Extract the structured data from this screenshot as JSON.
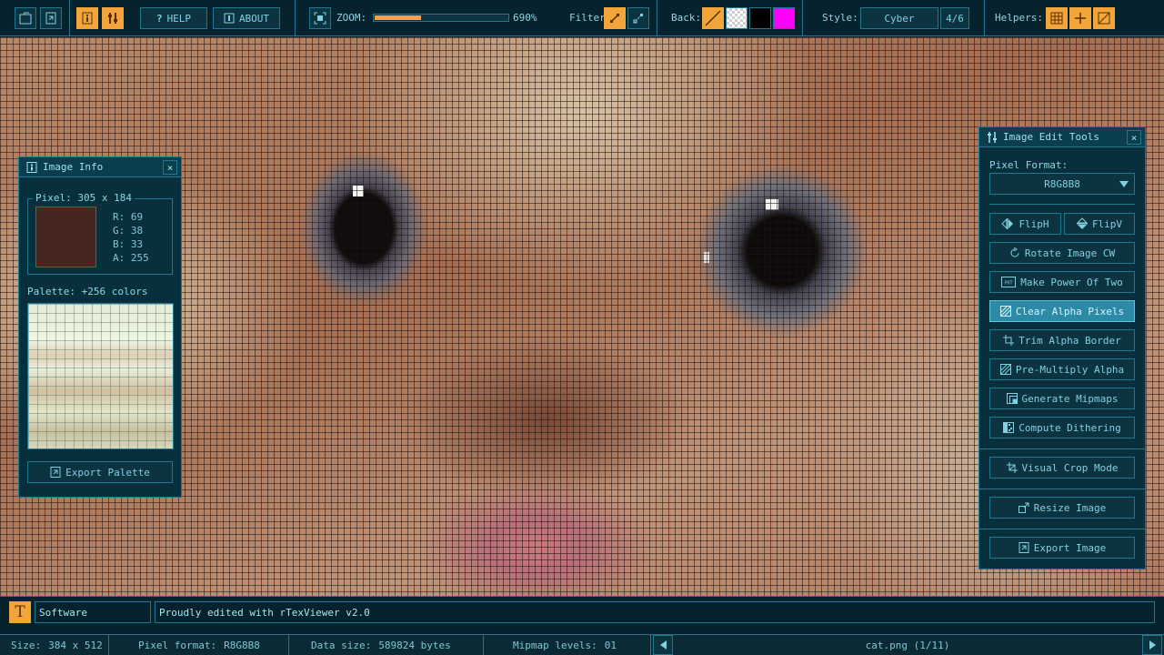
{
  "toolbar": {
    "help_label": "HELP",
    "about_label": "ABOUT",
    "zoom_label": "ZOOM:",
    "zoom_value": "690%",
    "zoom_fraction": 0.35,
    "filter_label": "Filter:",
    "back_label": "Back:",
    "style_label": "Style:",
    "style_value": "Cyber",
    "style_index": "4/6",
    "helpers_label": "Helpers:",
    "accent_color": "#f2a53a",
    "back_colors": [
      "transparent-slash",
      "checker",
      "#000000",
      "#ff00ff"
    ]
  },
  "image_info": {
    "title": "Image Info",
    "pixel_label": "Pixel: 305 x 184",
    "pixel_color": "#452621",
    "r": "R: 69",
    "g": "G: 38",
    "b": "B: 33",
    "a": "A: 255",
    "palette_label": "Palette: +256 colors",
    "export_palette": "Export Palette"
  },
  "edit_tools": {
    "title": "Image Edit Tools",
    "pixel_format_label": "Pixel Format:",
    "pixel_format_value": "R8G8B8",
    "flip_h": "FlipH",
    "flip_v": "FlipV",
    "rotate": "Rotate Image CW",
    "power_two": "Make Power Of Two",
    "clear_alpha": "Clear Alpha Pixels",
    "trim_alpha": "Trim Alpha Border",
    "premultiply": "Pre-Multiply Alpha",
    "mipmaps": "Generate Mipmaps",
    "dithering": "Compute Dithering",
    "crop": "Visual Crop Mode",
    "resize": "Resize Image",
    "export": "Export Image"
  },
  "textbar": {
    "key": "Software",
    "value": "Proudly edited with rTexViewer v2.0"
  },
  "status": {
    "size_label": "Size:",
    "size_value": "384 x 512",
    "format_label": "Pixel format:",
    "format_value": "R8G8B8",
    "data_label": "Data size:",
    "data_value": "589824 bytes",
    "mip_label": "Mipmap levels:",
    "mip_value": "01",
    "file": "cat.png (1/11)"
  }
}
